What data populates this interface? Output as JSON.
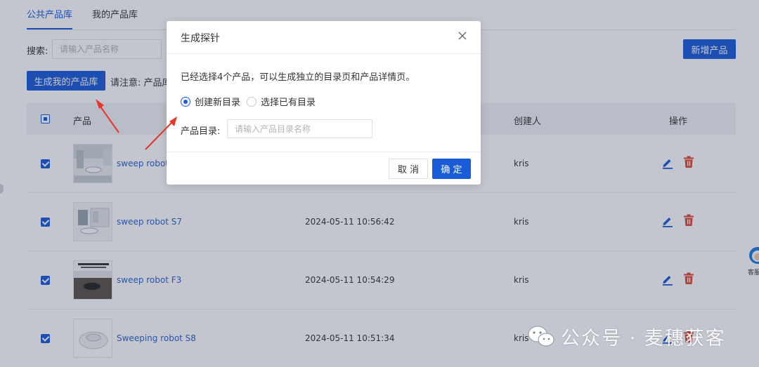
{
  "tabs": [
    {
      "label": "公共产品库",
      "active": true
    },
    {
      "label": "我的产品库",
      "active": false
    }
  ],
  "search": {
    "label": "搜索:",
    "placeholder": "请输入产品名称"
  },
  "buttons": {
    "new_product": "新增产品",
    "generate_library": "生成我的产品库"
  },
  "notice": "请注意: 产品库",
  "table": {
    "headers": {
      "product": "产品",
      "creator": "创建人",
      "actions": "操作"
    },
    "rows": [
      {
        "name": "sweep robot",
        "date": "",
        "creator": "kris",
        "checked": true
      },
      {
        "name": "sweep robot S7",
        "date": "2024-05-11 10:56:42",
        "creator": "kris",
        "checked": true
      },
      {
        "name": "sweep robot F3",
        "date": "2024-05-11 10:54:29",
        "creator": "kris",
        "checked": true
      },
      {
        "name": "Sweeping robot S8",
        "date": "2024-05-11 10:51:34",
        "creator": "kris",
        "checked": true
      }
    ]
  },
  "dialog": {
    "title": "生成探针",
    "message": "已经选择4个产品，可以生成独立的目录页和产品详情页。",
    "radio_new": "创建新目录",
    "radio_existing": "选择已有目录",
    "selected_option": "创建新目录",
    "directory_label": "产品目录:",
    "directory_placeholder": "请输入产品目录名称",
    "cancel": "取 消",
    "confirm": "确 定"
  },
  "service_label": "客服",
  "watermark": "公众号 · 麦穗获客",
  "colors": {
    "primary": "#1a5bd8",
    "link": "#2a62c9",
    "delete": "#e0452f",
    "arrow": "#e8352a"
  },
  "icons": {
    "edit": "edit-icon",
    "delete": "trash-icon",
    "close": "close-icon",
    "service": "headset-icon",
    "wechat": "wechat-icon"
  }
}
